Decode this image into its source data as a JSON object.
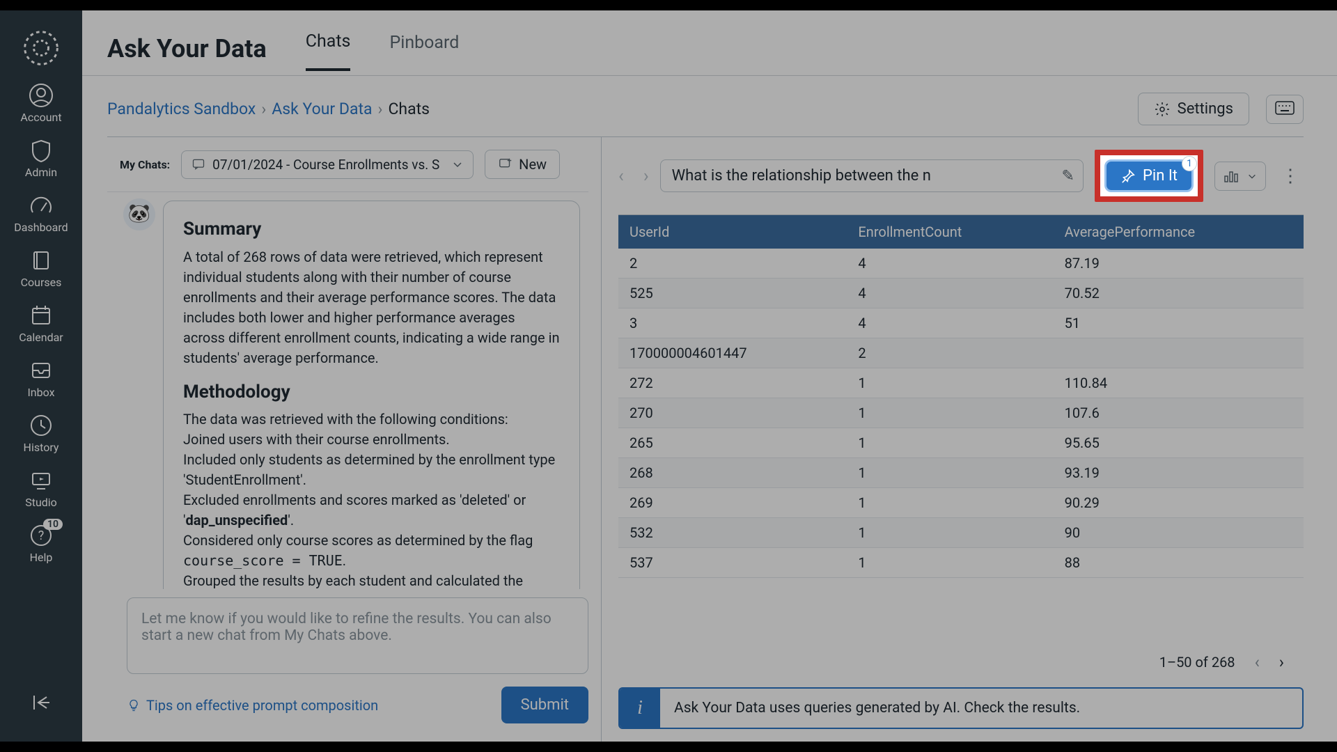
{
  "nav": {
    "items": [
      {
        "label": "Account"
      },
      {
        "label": "Admin"
      },
      {
        "label": "Dashboard"
      },
      {
        "label": "Courses"
      },
      {
        "label": "Calendar"
      },
      {
        "label": "Inbox"
      },
      {
        "label": "History"
      },
      {
        "label": "Studio"
      },
      {
        "label": "Help",
        "badge": "10"
      }
    ]
  },
  "topbar": {
    "title": "Ask Your Data",
    "tabs": [
      "Chats",
      "Pinboard"
    ],
    "active_tab": "Chats"
  },
  "breadcrumbs": [
    {
      "label": "Pandalytics Sandbox",
      "link": true
    },
    {
      "label": "Ask Your Data",
      "link": true
    },
    {
      "label": "Chats",
      "link": false
    }
  ],
  "settings_label": "Settings",
  "chat_header": {
    "my_chats": "My Chats:",
    "selected_chat": "07/01/2024 - Course Enrollments vs. S",
    "new_label": "New"
  },
  "summary": {
    "heading": "Summary",
    "body": "A total of 268 rows of data were retrieved, which represent individual students along with their number of course enrollments and their average performance scores. The data includes both lower and higher performance averages across different enrollment counts, indicating a wide range in students' average performance.",
    "method_heading": "Methodology",
    "m1": "The data was retrieved with the following conditions:",
    "m2": "Joined users with their course enrollments.",
    "m3": "Included only students as determined by the enrollment type 'StudentEnrollment'.",
    "m4_pre": "Excluded enrollments and scores marked as 'deleted' or '",
    "m4_bold": "dap_unspecified",
    "m4_post": "'.",
    "m5_pre": "Considered only course scores as determined by the flag ",
    "m5_code": "course_score = TRUE",
    "m5_post": ".",
    "m6": "Grouped the results by each student and calculated the"
  },
  "chat_input_placeholder": "Let me know if you would like to refine the results.  You can also start a new chat from My Chats above.",
  "tips_label": "Tips on effective prompt composition",
  "submit_label": "Submit",
  "result": {
    "query_text": "What is the relationship between the n",
    "pin_label": "Pin It",
    "pin_badge": "1",
    "columns": [
      "UserId",
      "EnrollmentCount",
      "AveragePerformance"
    ],
    "rows": [
      [
        "2",
        "4",
        "87.19"
      ],
      [
        "525",
        "4",
        "70.52"
      ],
      [
        "3",
        "4",
        "51"
      ],
      [
        "170000004601447",
        "2",
        ""
      ],
      [
        "272",
        "1",
        "110.84"
      ],
      [
        "270",
        "1",
        "107.6"
      ],
      [
        "265",
        "1",
        "95.65"
      ],
      [
        "268",
        "1",
        "93.19"
      ],
      [
        "269",
        "1",
        "90.29"
      ],
      [
        "532",
        "1",
        "90"
      ],
      [
        "537",
        "1",
        "88"
      ]
    ],
    "pager_text": "1–50 of 268",
    "info_text": "Ask Your Data uses queries generated by AI. Check the results."
  }
}
